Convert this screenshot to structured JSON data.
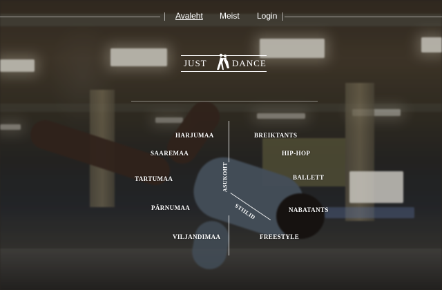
{
  "nav": {
    "items": [
      {
        "label": "Avaleht",
        "active": true
      },
      {
        "label": "Meist",
        "active": false
      },
      {
        "label": "Login",
        "active": false
      }
    ]
  },
  "logo": {
    "left_text": "JUST",
    "right_text": "DANCE"
  },
  "locations": {
    "axis_label": "ASUKOHT",
    "items": [
      "HARJUMAA",
      "SAAREMAA",
      "TARTUMAA",
      "PÄRNUMAA",
      "VILJANDIMAA"
    ]
  },
  "styles": {
    "axis_label": "STIILID",
    "items": [
      "BREIKTANTS",
      "HIP-HOP",
      "BALLETT",
      "NABATANTS",
      "FREESTYLE"
    ]
  },
  "colors": {
    "text": "#ffffff",
    "accent_line": "#ffffff"
  }
}
